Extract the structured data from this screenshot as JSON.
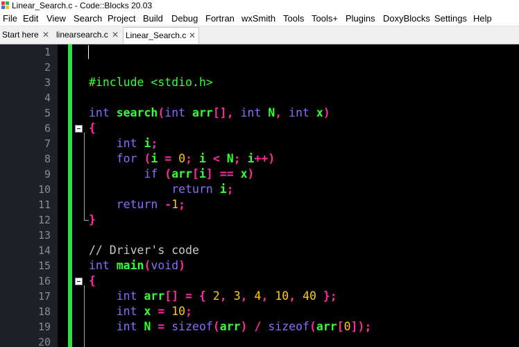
{
  "window": {
    "title": "Linear_Search.c - Code::Blocks 20.03"
  },
  "menu": [
    "File",
    "Edit",
    "View",
    "Search",
    "Project",
    "Build",
    "Debug",
    "Fortran",
    "wxSmith",
    "Tools",
    "Tools+",
    "Plugins",
    "DoxyBlocks",
    "Settings",
    "Help"
  ],
  "tabs": [
    {
      "label": "Start here",
      "close": "✕"
    },
    {
      "label": "linearsearch.c",
      "close": "✕"
    },
    {
      "label": "Linear_Search.c",
      "close": "✕"
    }
  ],
  "colors": {
    "gutter": "#1e2129",
    "change_bar": "#33dd44",
    "editor_bg": "#000000",
    "keyword": "#8c6cff",
    "identifier": "#33ff33",
    "operator": "#ff2aa0",
    "number": "#ffcc00"
  },
  "icons": {
    "window": "codeblocks-icon",
    "fold": "fold-minus-icon"
  },
  "line_numbers": [
    "1",
    "2",
    "3",
    "4",
    "5",
    "6",
    "7",
    "8",
    "9",
    "10",
    "11",
    "12",
    "13",
    "14",
    "15",
    "16",
    "17",
    "18",
    "19",
    "20"
  ],
  "code": {
    "l3": [
      "#include <stdio.h>"
    ],
    "l5": [
      "int",
      " ",
      "search",
      "(",
      "int",
      " ",
      "arr",
      "[],",
      " ",
      "int",
      " ",
      "N",
      ",",
      " ",
      "int",
      " ",
      "x",
      ")"
    ],
    "l6": [
      "{"
    ],
    "l7": [
      "    ",
      "int",
      " ",
      "i",
      ";"
    ],
    "l8": [
      "    ",
      "for",
      " ",
      "(",
      "i",
      " ",
      "=",
      " ",
      "0",
      ";",
      " ",
      "i",
      " ",
      "<",
      " ",
      "N",
      ";",
      " ",
      "i",
      "++)"
    ],
    "l9": [
      "        ",
      "if",
      " ",
      "(",
      "arr",
      "[",
      "i",
      "]",
      " ",
      "==",
      " ",
      "x",
      ")"
    ],
    "l10": [
      "            ",
      "return",
      " ",
      "i",
      ";"
    ],
    "l11": [
      "    ",
      "return",
      " ",
      "-",
      "1",
      ";"
    ],
    "l12": [
      "}"
    ],
    "l14": [
      "// Driver's code"
    ],
    "l15": [
      "int",
      " ",
      "main",
      "(",
      "void",
      ")"
    ],
    "l16": [
      "{"
    ],
    "l17": [
      "    ",
      "int",
      " ",
      "arr",
      "[]",
      " ",
      "=",
      " ",
      "{",
      " ",
      "2",
      ",",
      " ",
      "3",
      ",",
      " ",
      "4",
      ",",
      " ",
      "10",
      ",",
      " ",
      "40",
      " ",
      "};"
    ],
    "l18": [
      "    ",
      "int",
      " ",
      "x",
      " ",
      "=",
      " ",
      "10",
      ";"
    ],
    "l19": [
      "    ",
      "int",
      " ",
      "N",
      " ",
      "=",
      " ",
      "sizeof",
      "(",
      "arr",
      ")",
      " ",
      "/",
      " ",
      "sizeof",
      "(",
      "arr",
      "[",
      "0",
      "]);"
    ]
  }
}
